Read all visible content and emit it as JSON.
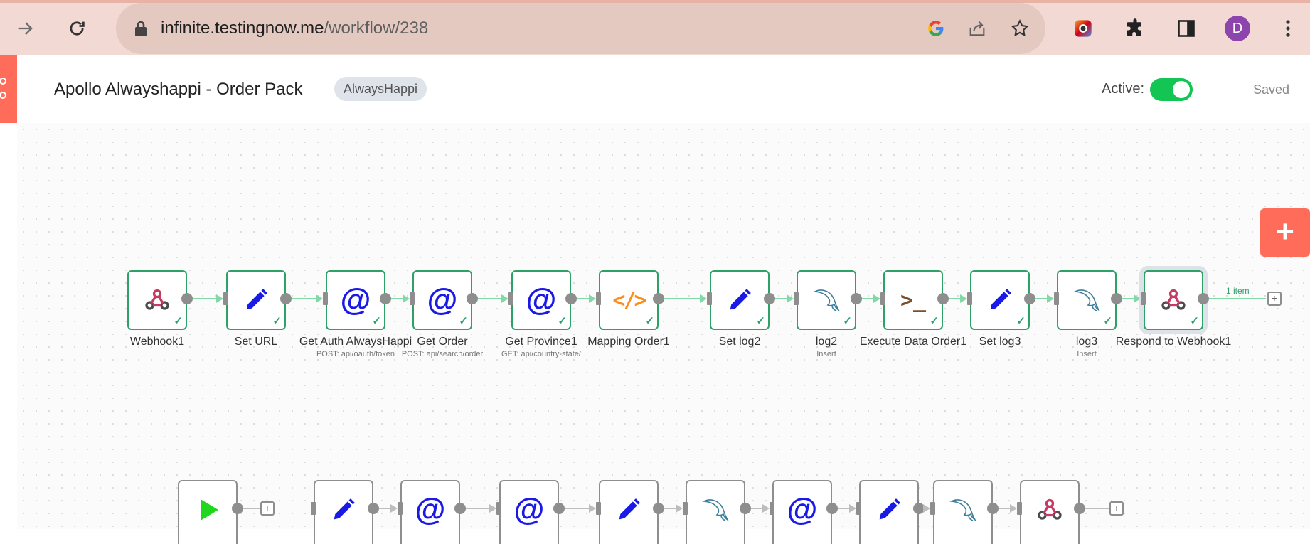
{
  "browser": {
    "url_domain": "infinite.testingnow.me",
    "url_path": "/workflow/238",
    "profile_initial": "D"
  },
  "header": {
    "title": "Apollo Alwayshappi - Order Pack",
    "tag": "AlwaysHappi",
    "active_label": "Active:",
    "active": true,
    "status": "Saved"
  },
  "canvas": {
    "add_button": "+",
    "main_flow": [
      {
        "label": "Webhook1",
        "subtitle": "",
        "icon": "webhook-icon"
      },
      {
        "label": "Set URL",
        "subtitle": "",
        "icon": "pencil-icon"
      },
      {
        "label": "Get Auth AlwaysHappi",
        "subtitle": "POST: api/oauth/token",
        "icon": "http-request-icon"
      },
      {
        "label": "Get Order",
        "subtitle": "POST: api/search/order",
        "icon": "http-request-icon"
      },
      {
        "label": "Get Province1",
        "subtitle": "GET: api/country-state/",
        "icon": "http-request-icon"
      },
      {
        "label": "Mapping Order1",
        "subtitle": "",
        "icon": "code-icon"
      },
      {
        "label": "Set log2",
        "subtitle": "",
        "icon": "pencil-icon"
      },
      {
        "label": "log2",
        "subtitle": "Insert",
        "icon": "mysql-dolphin-icon"
      },
      {
        "label": "Execute Data Order1",
        "subtitle": "",
        "icon": "terminal-icon"
      },
      {
        "label": "Set log3",
        "subtitle": "",
        "icon": "pencil-icon"
      },
      {
        "label": "log3",
        "subtitle": "Insert",
        "icon": "mysql-dolphin-icon"
      },
      {
        "label": "Respond to Webhook1",
        "subtitle": "",
        "icon": "webhook-icon"
      }
    ],
    "items_label": "1 item",
    "second_flow_icons": [
      "play-icon",
      "pencil-icon",
      "http-request-icon",
      "http-request-icon",
      "pencil-icon",
      "mysql-dolphin-icon",
      "http-request-icon",
      "pencil-icon",
      "mysql-dolphin-icon",
      "webhook-icon"
    ]
  },
  "colors": {
    "accent": "#ff6d5a",
    "success": "#2ea169",
    "toggle_on": "#13c552",
    "http_blue": "#1a1ae6"
  }
}
